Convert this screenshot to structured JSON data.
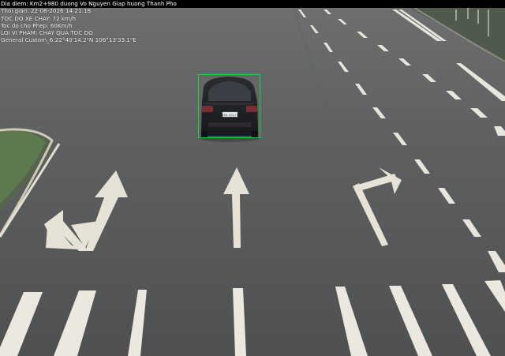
{
  "overlay": {
    "location_line": "Dia diem: Km2+980 duong Vo Nguyen Giap huong Thanh Pho",
    "time_line": "Thoi gian: 22-08-2026 14:21:18",
    "speed_line": "TOC DO XE CHAY: 72 km/h",
    "limit_line": "Toc do cho Phep: 60Km/h",
    "violation_line": "LOI VI PHAM: CHAY QUA TOC DO",
    "gps_line": "General Custom_6:22°40'14.2\"N 106°13'33.1\"E"
  },
  "vehicle": {
    "plate": "14A 123.73"
  },
  "colors": {
    "road": "#5a5c5d",
    "lane_marking": "#e8e6dc",
    "detection_box": "#1fd23a"
  }
}
